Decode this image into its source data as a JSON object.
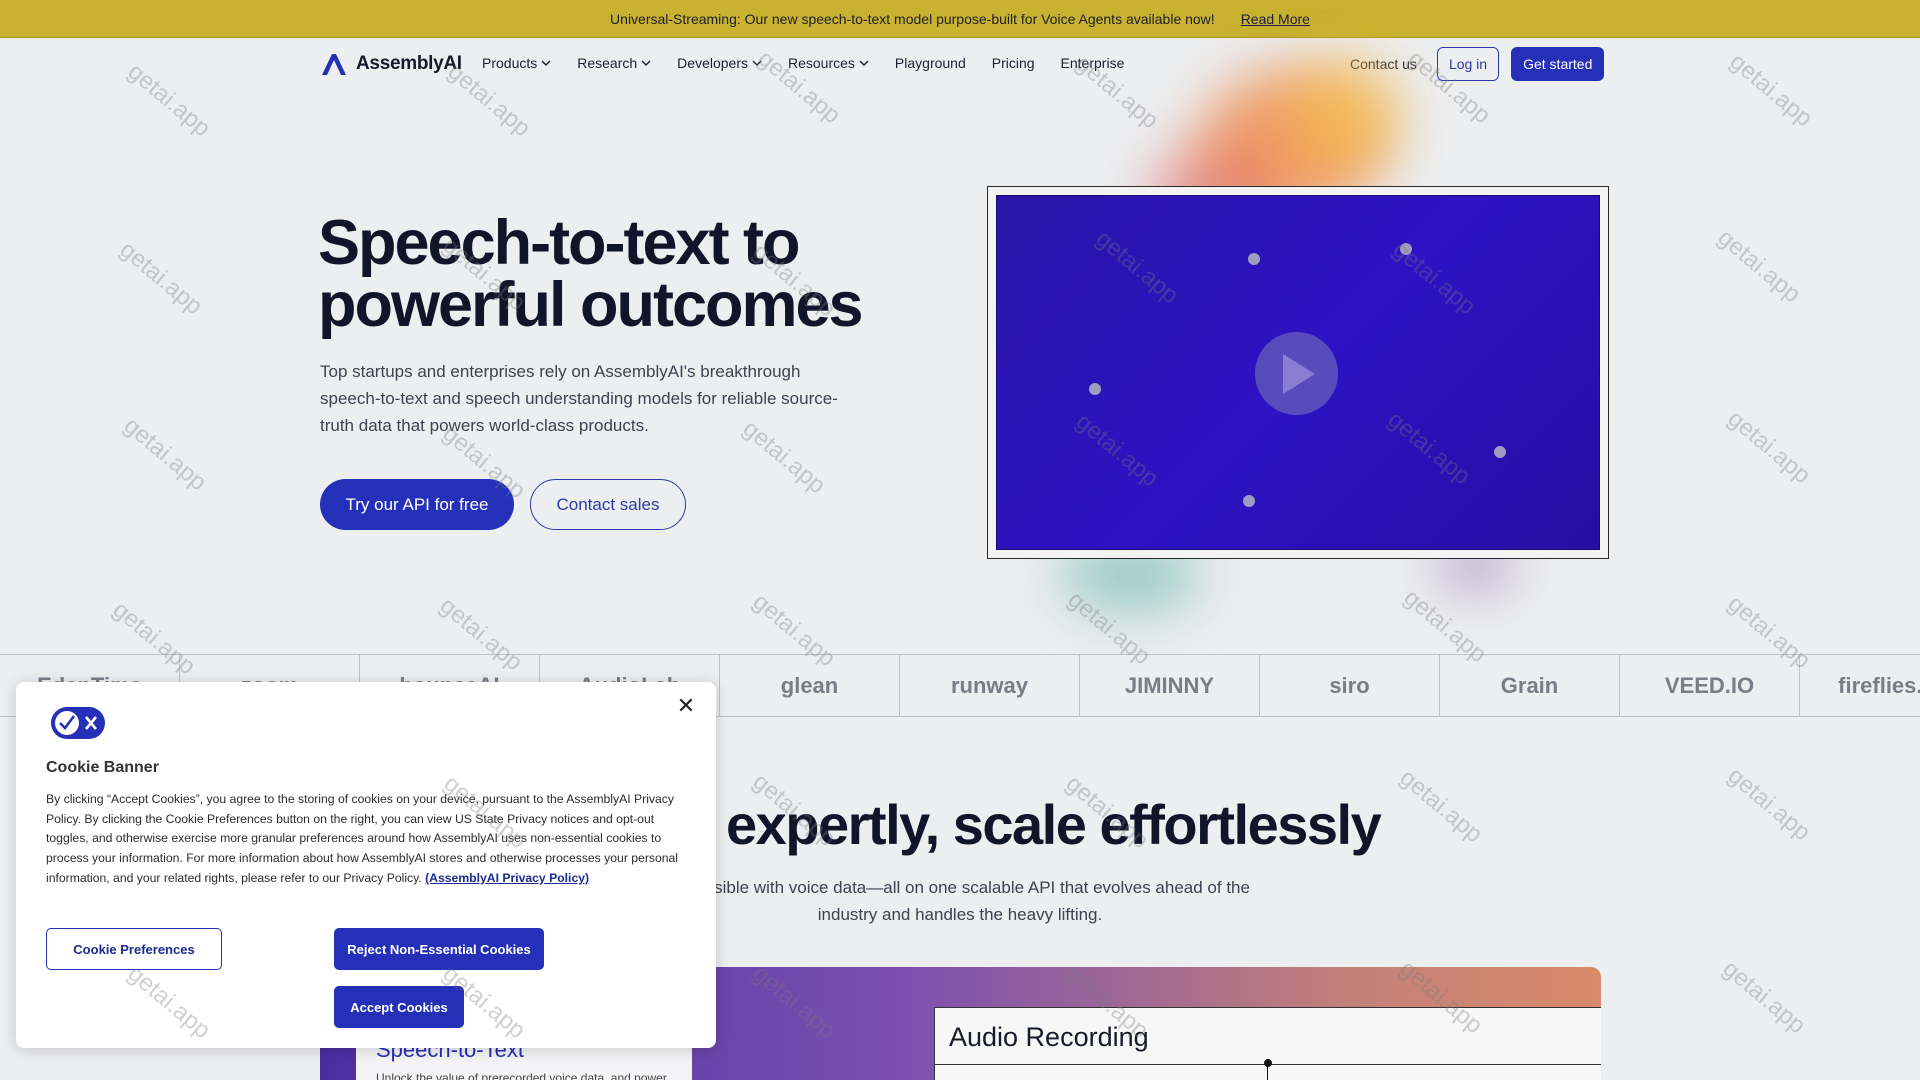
{
  "announcement": {
    "text": "Universal-Streaming: Our new speech-to-text model purpose-built for Voice Agents available now!",
    "link": "Read More"
  },
  "nav": {
    "brand": "AssemblyAI",
    "items": [
      {
        "label": "Products",
        "dropdown": true
      },
      {
        "label": "Research",
        "dropdown": true
      },
      {
        "label": "Developers",
        "dropdown": true
      },
      {
        "label": "Resources",
        "dropdown": true
      },
      {
        "label": "Playground",
        "dropdown": false
      },
      {
        "label": "Pricing",
        "dropdown": false
      },
      {
        "label": "Enterprise",
        "dropdown": false
      }
    ],
    "contact": "Contact us",
    "login": "Log in",
    "get_started": "Get started"
  },
  "hero": {
    "title_line1": "Speech-to-text to",
    "title_line2": "powerful outcomes",
    "subtitle": "Top startups and enterprises rely on AssemblyAI's breakthrough speech-to-text and speech understanding models for reliable source-truth data that powers world-class products.",
    "try_button": "Try our API for free",
    "contact_button": "Contact sales",
    "video_play_icon": "play-icon"
  },
  "logos": [
    "EdenTime",
    "zoom",
    "bounceAI",
    "AudioLab",
    "glean",
    "runway",
    "JIMINNY",
    "siro",
    "Grain",
    "VEED.IO",
    "fireflies.ai"
  ],
  "section": {
    "title": "expertly, scale effortlessly",
    "subtitle_line1": "’s possible with voice data—all on one scalable API that evolves ahead of the",
    "subtitle_line2": "industry and handles the heavy lifting."
  },
  "demo": {
    "card_title": "Speech-to-Text",
    "card_text": "Unlock the value of prerecorded voice data, and power",
    "audio_title": "Audio Recording"
  },
  "cookie": {
    "title": "Cookie Banner",
    "body": "By clicking “Accept Cookies”, you agree to the storing of cookies on your device, pursuant to the AssemblyAI Privacy Policy. By clicking the Cookie Preferences button on the right, you can view US State Privacy notices and opt-out toggles, and otherwise exercise more granular preferences around how AssemblyAI uses non-essential cookies to process your information. For more information about how AssemblyAI stores and otherwise processes your personal information, and your related rights, please refer to our Privacy Policy.",
    "policy_link": "(AssemblyAI Privacy Policy)",
    "preferences_button": "Cookie Preferences",
    "reject_button": "Reject Non-Essential Cookies",
    "accept_button": "Accept Cookies",
    "close_icon": "close-icon"
  },
  "watermark": "getai.app",
  "colors": {
    "announce_bg": "#c8b230",
    "primary": "#2430b8",
    "video_bg": "#2e12c4"
  }
}
